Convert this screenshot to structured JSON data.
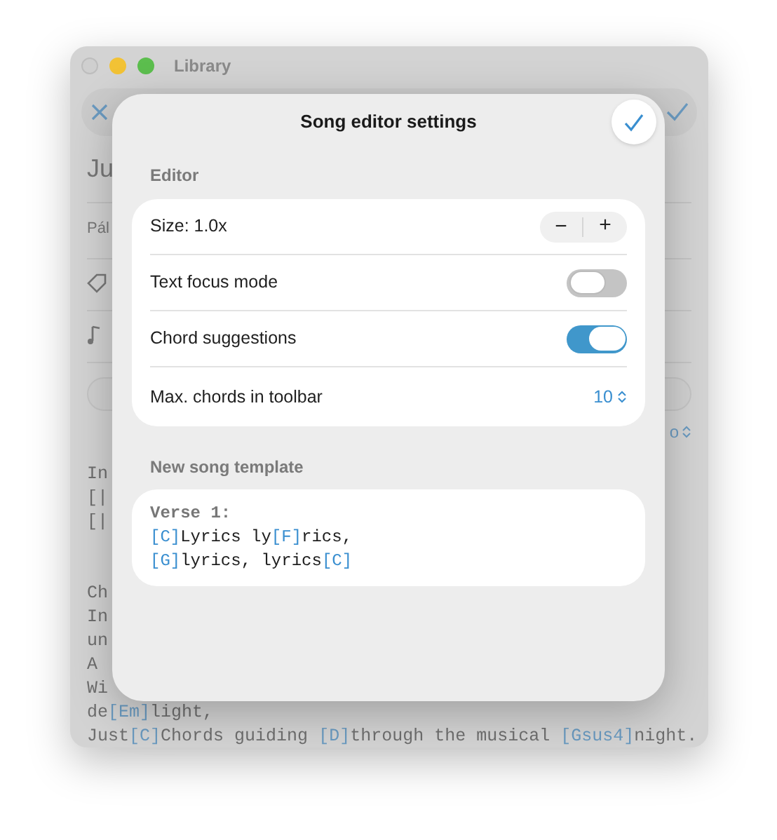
{
  "window": {
    "title": "Library"
  },
  "background": {
    "title": "Ju",
    "subtitle": "Pál",
    "picker_value": "o",
    "stanzas": [
      [
        "In",
        "[|",
        "[|"
      ],
      [
        "Ch",
        "In",
        "un",
        "A",
        "Wi",
        "de[Em]light,",
        "Just[C]Chords guiding [D]through the musical [Gsus4]night."
      ]
    ]
  },
  "dialog": {
    "title": "Song editor settings",
    "sections": [
      {
        "header": "Editor",
        "rows": [
          {
            "kind": "stepper",
            "label": "Size: 1.0x",
            "minus": "−",
            "plus": "+"
          },
          {
            "kind": "toggle",
            "label": "Text focus mode",
            "on": false
          },
          {
            "kind": "toggle",
            "label": "Chord suggestions",
            "on": true
          },
          {
            "kind": "picker",
            "label": "Max. chords in toolbar",
            "value": "10"
          }
        ]
      },
      {
        "header": "New song template",
        "template": [
          "Verse 1:",
          "[C]Lyrics ly[F]rics,",
          "[G]lyrics, lyrics[C]"
        ]
      }
    ]
  }
}
